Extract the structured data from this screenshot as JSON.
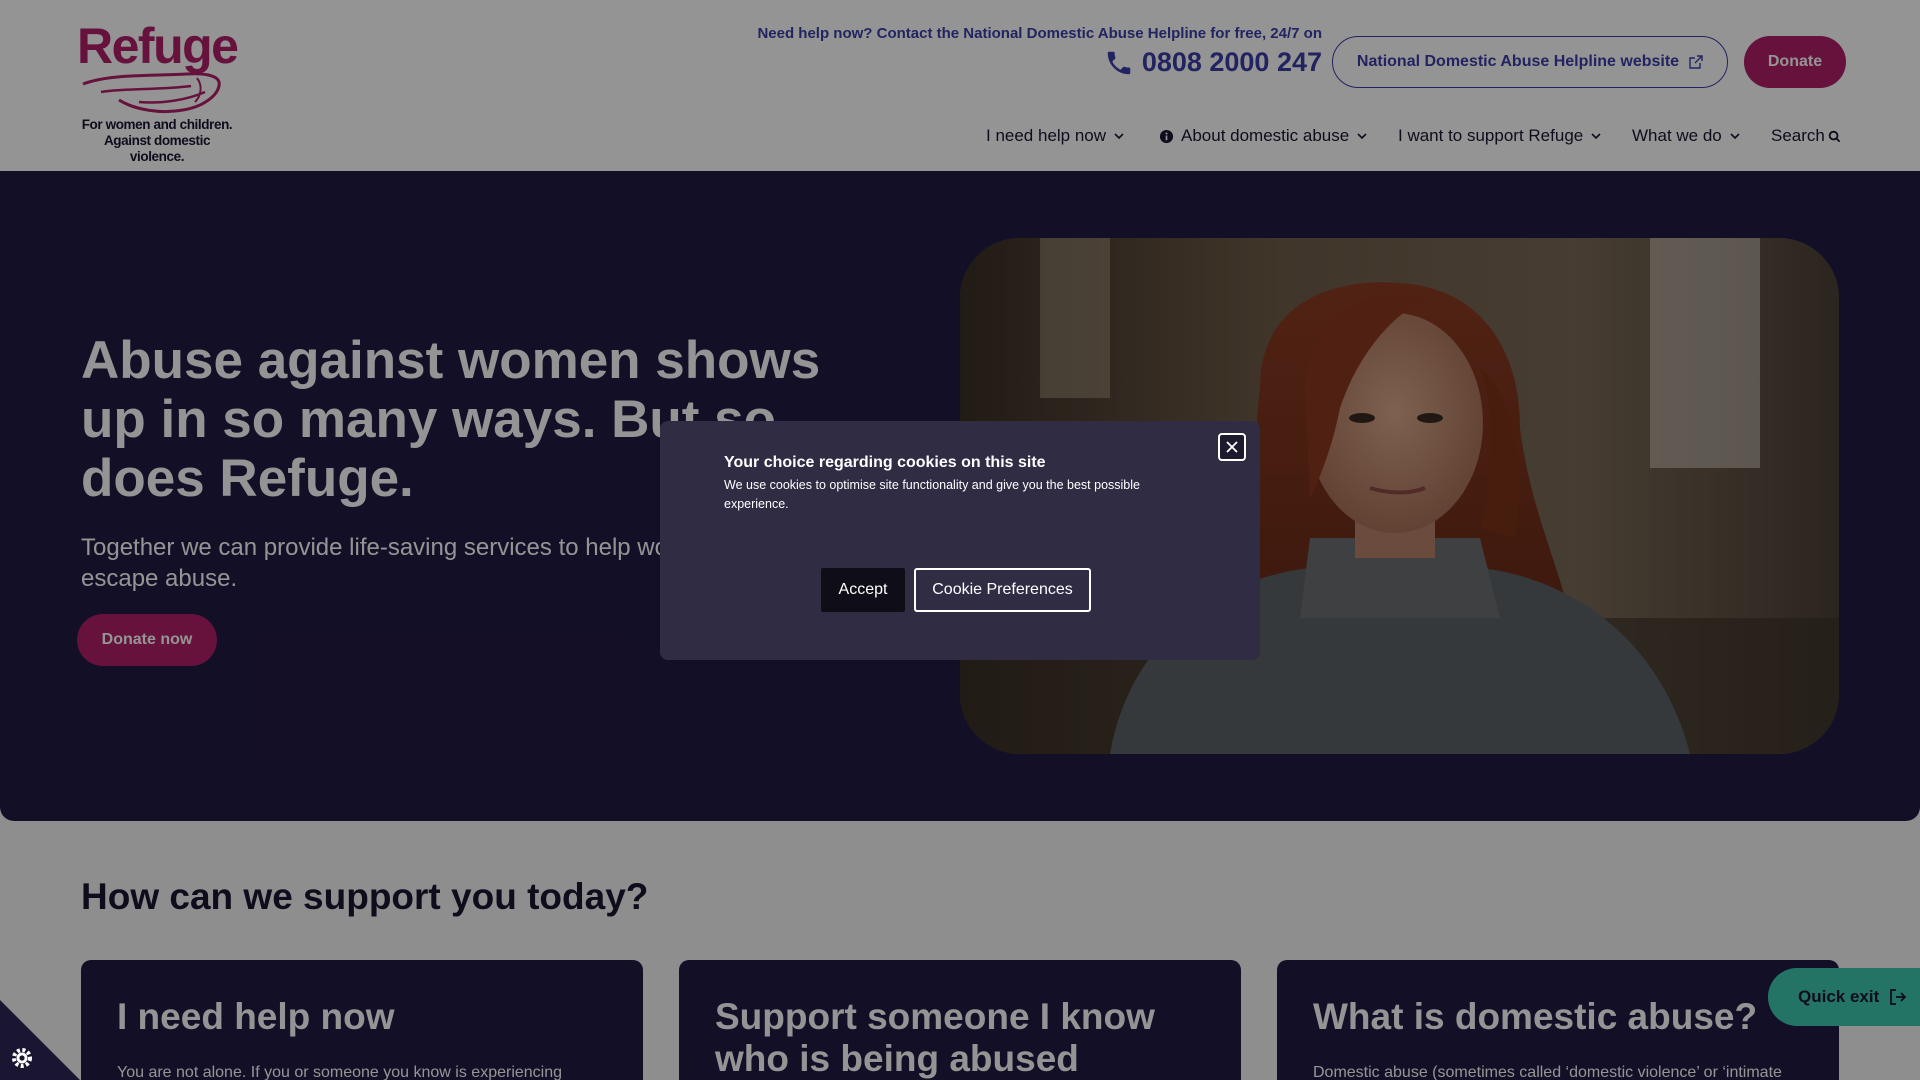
{
  "header": {
    "logo": {
      "word": "Refuge",
      "tagline_line1": "For women and children.",
      "tagline_line2": "Against domestic violence."
    },
    "helpline_text": "Need help now? Contact the National Domestic Abuse Helpline for free, 24/7 on",
    "phone": "0808 2000 247",
    "helpline_button": "National Domestic Abuse Helpline website",
    "donate_button": "Donate"
  },
  "nav": {
    "items": [
      {
        "label": "I need help now"
      },
      {
        "label": "About domestic abuse"
      },
      {
        "label": "I want to support Refuge"
      },
      {
        "label": "What we do"
      },
      {
        "label": "Search"
      }
    ]
  },
  "hero": {
    "title": "Abuse against women shows up in so many ways. But so does Refuge.",
    "subtitle": "Together we can provide life-saving services to help women and children escape abuse.",
    "donate_now": "Donate now"
  },
  "support": {
    "title": "How can we support you today?",
    "cards": [
      {
        "title": "I need help now",
        "text": "You are not alone. If you or someone you know is experiencing"
      },
      {
        "title": "Support someone I know who is being abused",
        "text": ""
      },
      {
        "title": "What is domestic abuse?",
        "text": "Domestic abuse (sometimes called ‘domestic violence’ or ‘intimate"
      }
    ]
  },
  "quick_exit": "Quick exit",
  "cookie": {
    "title": "Your choice regarding cookies on this site",
    "body": "We use cookies to optimise site functionality and give you the best possible experience.",
    "accept": "Accept",
    "preferences": "Cookie Preferences"
  },
  "colors": {
    "brand": "#b0206a",
    "navy": "#221a44",
    "link": "#3b3ea8",
    "quick_exit": "#3fc8b0"
  },
  "icons": [
    "phone-icon",
    "external-link-icon",
    "chevron-down-icon",
    "info-icon",
    "search-icon",
    "close-icon",
    "exit-icon",
    "gear-icon"
  ]
}
